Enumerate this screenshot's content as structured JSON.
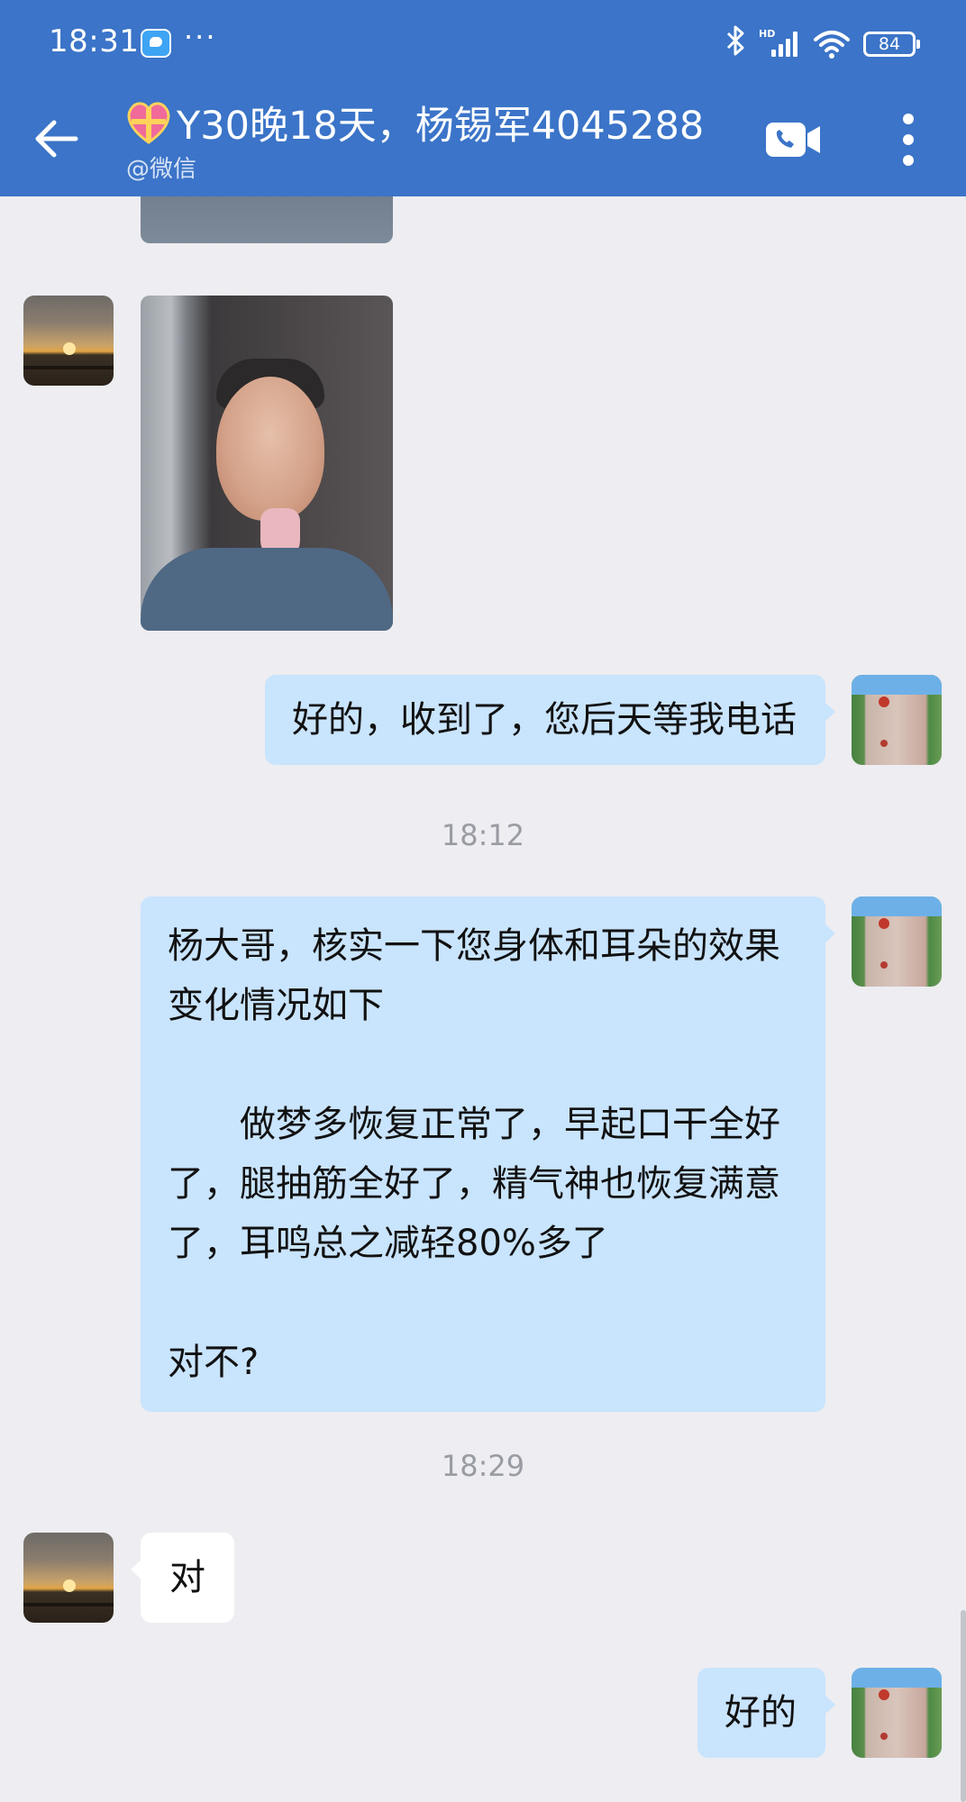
{
  "status_bar": {
    "time": "18:31",
    "more": "···",
    "battery": "84",
    "network": "HD"
  },
  "header": {
    "title": "Y30晚18天，杨锡军4045288",
    "subtitle": "@微信",
    "back_icon": "arrow-left-icon",
    "call_icon": "video-call-icon",
    "menu_icon": "more-vertical-icon",
    "title_icon": "heart-gift-icon"
  },
  "messages": [
    {
      "type": "image",
      "direction": "in"
    },
    {
      "type": "image",
      "direction": "in"
    },
    {
      "type": "text",
      "direction": "out",
      "text": "好的，收到了，您后天等我电话"
    },
    {
      "type": "time",
      "text": "18:12"
    },
    {
      "type": "text",
      "direction": "out",
      "lines": [
        "杨大哥，核实一下您身体和耳朵的效果变化情况如下",
        "做梦多恢复正常了，早起口干全好了，腿抽筋全好了，精气神也恢复满意了，耳鸣总之减轻80%多了",
        "对不?"
      ]
    },
    {
      "type": "time",
      "text": "18:29"
    },
    {
      "type": "text",
      "direction": "in",
      "text": "对"
    },
    {
      "type": "text",
      "direction": "out",
      "text": "好的"
    }
  ],
  "colors": {
    "header_bg": "#3b74c8",
    "chat_bg": "#ededf2",
    "outgoing_bubble": "#c9e4fd",
    "incoming_bubble": "#ffffff"
  }
}
